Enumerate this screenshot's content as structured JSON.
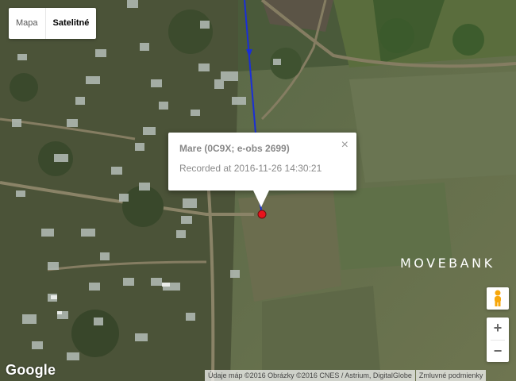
{
  "map": {
    "type_control": {
      "map_label": "Mapa",
      "satellite_label": "Satelitné",
      "active": "satellite"
    },
    "popup": {
      "title": "Mare (0C9X; e-obs 2699)",
      "text": "Recorded at 2016-11-26 14:30:21",
      "close_label": "×"
    },
    "watermark": "MOVEBANK",
    "zoom_in_label": "+",
    "zoom_out_label": "−",
    "google_logo": "Google",
    "attribution": "Údaje máp ©2016 Obrázky ©2016 CNES / Astrium, DigitalGlobe",
    "terms_label": "Zmluvné podmienky",
    "colors": {
      "track": "#1a2fd6",
      "marker": "#e8131c",
      "background": "#4a5a3a"
    }
  }
}
